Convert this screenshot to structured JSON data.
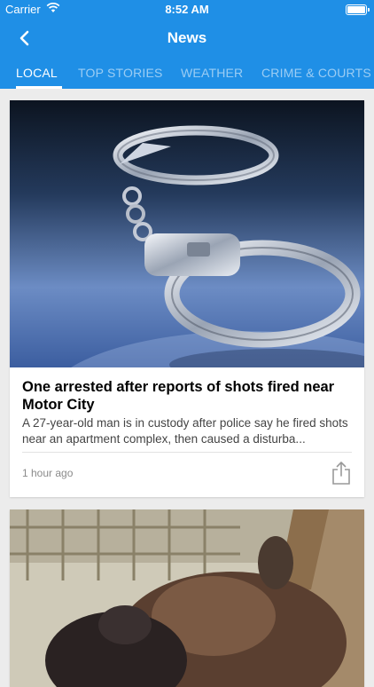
{
  "status_bar": {
    "carrier": "Carrier",
    "time": "8:52 AM"
  },
  "nav": {
    "title": "News",
    "back_icon": "chevron-left-icon"
  },
  "tabs": [
    {
      "label": "LOCAL",
      "active": true
    },
    {
      "label": "TOP STORIES",
      "active": false
    },
    {
      "label": "WEATHER",
      "active": false
    },
    {
      "label": "CRIME & COURTS",
      "active": false
    }
  ],
  "colors": {
    "header": "#1f8fe6",
    "background": "#ececec",
    "card": "#ffffff"
  },
  "articles": [
    {
      "image": "handcuffs-photo",
      "headline": "One arrested after reports of shots fired near Motor City",
      "summary": "A 27-year-old man is in custody after police say he fired shots near an apartment complex, then caused a disturba...",
      "time": "1 hour ago",
      "share_icon": "share-icon"
    },
    {
      "image": "animals-photo"
    }
  ]
}
